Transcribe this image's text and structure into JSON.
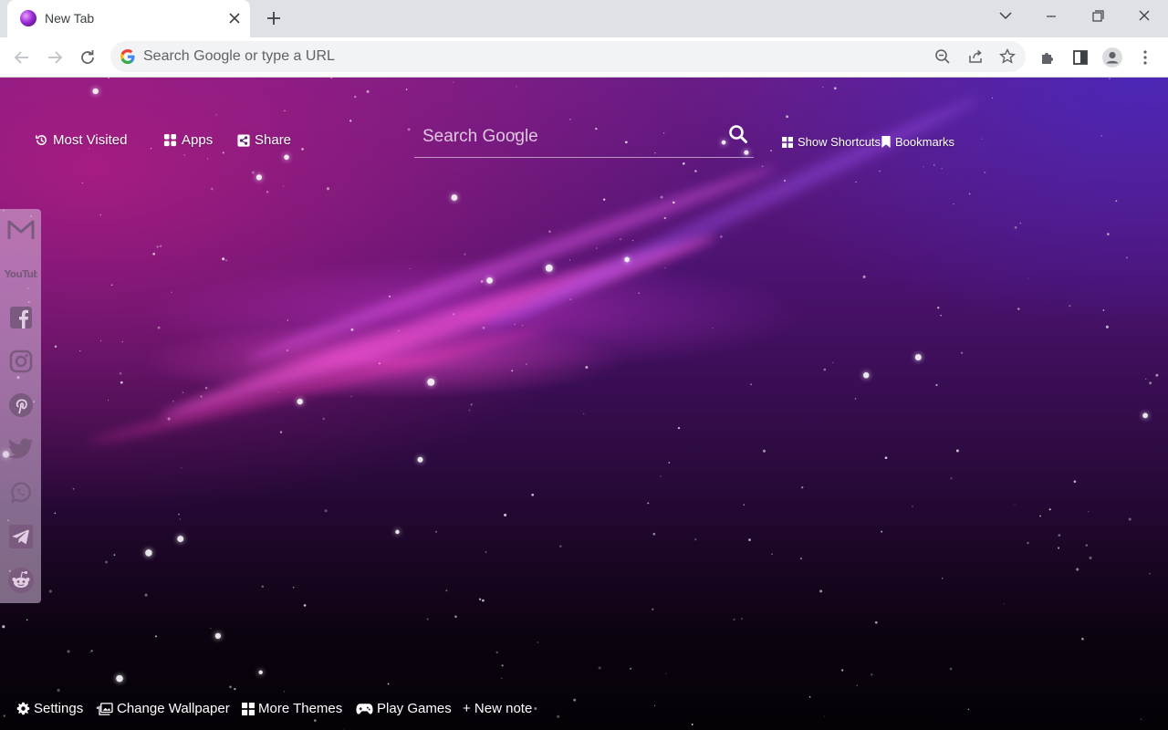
{
  "browser": {
    "tab": {
      "title": "New Tab",
      "favicon": "purple-orb-icon"
    },
    "omnibox": {
      "placeholder": "Search Google or type a URL"
    },
    "colors": {
      "tabstrip": "#dee1e6",
      "toolbar": "#ffffff",
      "omnibox": "#f1f3f4",
      "icon": "#5f6368"
    }
  },
  "page": {
    "toplinks": {
      "most_visited": "Most Visited",
      "apps": "Apps",
      "share": "Share",
      "show_shortcuts": "Show Shortcuts",
      "bookmarks": "Bookmarks"
    },
    "search": {
      "placeholder": "Search Google"
    },
    "sidebar": {
      "items": [
        {
          "name": "gmail",
          "icon": "gmail-icon"
        },
        {
          "name": "youtube",
          "icon": "youtube-icon",
          "label": "YouTube"
        },
        {
          "name": "facebook",
          "icon": "facebook-icon"
        },
        {
          "name": "instagram",
          "icon": "instagram-icon"
        },
        {
          "name": "pinterest",
          "icon": "pinterest-icon"
        },
        {
          "name": "twitter",
          "icon": "twitter-icon"
        },
        {
          "name": "whatsapp",
          "icon": "whatsapp-icon"
        },
        {
          "name": "telegram",
          "icon": "telegram-icon"
        },
        {
          "name": "reddit",
          "icon": "reddit-icon"
        }
      ]
    },
    "bottom": {
      "settings": "Settings",
      "change_wallpaper": "Change Wallpaper",
      "more_themes": "More Themes",
      "play_games": "Play Games",
      "new_note": "+ New note"
    },
    "colors": {
      "text": "#ffffff",
      "sidebar_icon": "#7a5a7e",
      "accent_pink": "#ff4fd8",
      "accent_violet": "#5a2fc0"
    }
  }
}
